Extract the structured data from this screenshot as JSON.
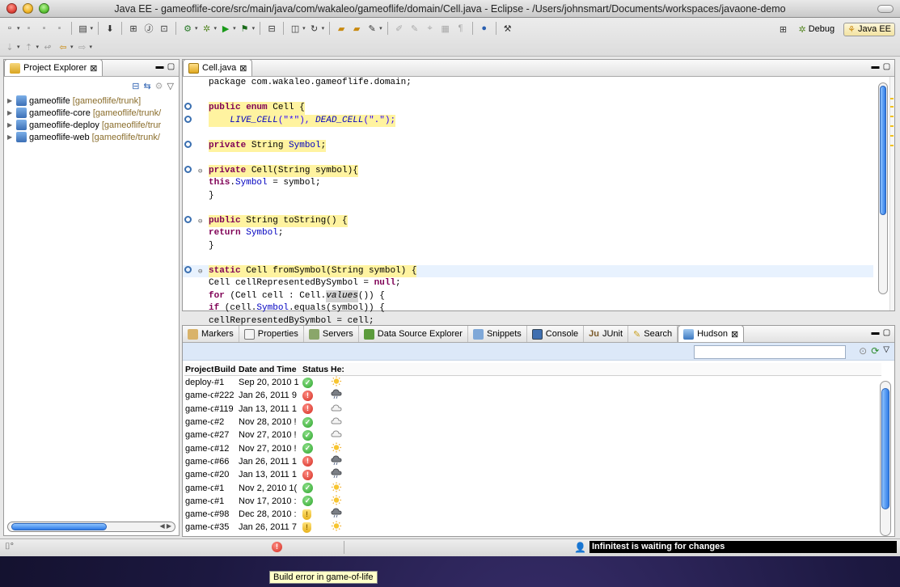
{
  "window": {
    "title": "Java EE - gameoflife-core/src/main/java/com/wakaleo/gameoflife/domain/Cell.java - Eclipse - /Users/johnsmart/Documents/workspaces/javaone-demo"
  },
  "perspectives": {
    "debug_label": "Debug",
    "javaee_label": "Java EE"
  },
  "project_explorer": {
    "title": "Project Explorer",
    "items": [
      {
        "name": "gameoflife",
        "repo": "[gameoflife/trunk]"
      },
      {
        "name": "gameoflife-core",
        "repo": "[gameoflife/trunk/"
      },
      {
        "name": "gameoflife-deploy",
        "repo": "[gameoflife/trur"
      },
      {
        "name": "gameoflife-web",
        "repo": "[gameoflife/trunk/"
      }
    ]
  },
  "editor": {
    "tab_label": "Cell.java",
    "code": {
      "l1": "package com.wakaleo.gameoflife.domain;",
      "l3a": "public enum",
      "l3b": " Cell {",
      "l4a": "LIVE_CELL",
      "l4b": "(\"*\"), ",
      "l4c": "DEAD_CELL",
      "l4d": "(\".\");",
      "l6a": "private",
      "l6b": " String ",
      "l6c": "Symbol",
      "l6d": ";",
      "l8a": "private",
      "l8b": " Cell(String symbol){",
      "l9a": "this",
      "l9b": ".",
      "l9c": "Symbol",
      "l9d": " = symbol;",
      "l10": "}",
      "l12a": "public",
      "l12b": " String toString() {",
      "l13a": "return",
      "l13b": " ",
      "l13c": "Symbol",
      "l13d": ";",
      "l14": "}",
      "l16a": "static",
      "l16b": " Cell fromSymbol(String symbol) {",
      "l17a": "Cell cellRepresentedBySymbol = ",
      "l17b": "null",
      "l17c": ";",
      "l18a": "for",
      "l18b": " (Cell cell : Cell.",
      "l18c": "values",
      "l18d": "()) {",
      "l19a": "if",
      "l19b": " (cell.",
      "l19c": "Symbol",
      "l19d": ".equals(symbol)) {",
      "l20": "cellRepresentedBySymbol = cell;"
    }
  },
  "bottom_tabs": {
    "markers": "Markers",
    "properties": "Properties",
    "servers": "Servers",
    "dse": "Data Source Explorer",
    "snippets": "Snippets",
    "console": "Console",
    "junit": "JUnit",
    "search": "Search",
    "hudson": "Hudson"
  },
  "hudson": {
    "headers": {
      "project": "Project",
      "build": "Build",
      "date": "Date and Time",
      "status": "Status",
      "health": "He:"
    },
    "rows": [
      {
        "project": "deploy-",
        "build": "#1",
        "date": "Sep 20, 2010 1",
        "status": "success",
        "health": "sunny"
      },
      {
        "project": "game-c",
        "build": "#222",
        "date": "Jan 26, 2011 9",
        "status": "failure",
        "health": "stormy"
      },
      {
        "project": "game-c",
        "build": "#119",
        "date": "Jan 13, 2011 1",
        "status": "failure",
        "health": "cloudy"
      },
      {
        "project": "game-c",
        "build": "#2",
        "date": "Nov 28, 2010 !",
        "status": "success",
        "health": "cloudy"
      },
      {
        "project": "game-c",
        "build": "#27",
        "date": "Nov 27, 2010 !",
        "status": "success",
        "health": "cloudy"
      },
      {
        "project": "game-c",
        "build": "#12",
        "date": "Nov 27, 2010 !",
        "status": "success",
        "health": "sunny"
      },
      {
        "project": "game-c",
        "build": "#66",
        "date": "Jan 26, 2011 1",
        "status": "failure",
        "health": "stormy"
      },
      {
        "project": "game-c",
        "build": "#20",
        "date": "Jan 13, 2011 1",
        "status": "failure",
        "health": "stormy"
      },
      {
        "project": "game-c",
        "build": "#1",
        "date": "Nov 2, 2010 1(",
        "status": "success",
        "health": "sunny"
      },
      {
        "project": "game-c",
        "build": "#1",
        "date": "Nov 17, 2010 :",
        "status": "success",
        "health": "sunny"
      },
      {
        "project": "game-c",
        "build": "#98",
        "date": "Dec 28, 2010 :",
        "status": "unstable",
        "health": "stormy"
      },
      {
        "project": "game-c",
        "build": "#35",
        "date": "Jan 26, 2011 7",
        "status": "unstable",
        "health": "sunny"
      }
    ]
  },
  "statusbar": {
    "infinitest": "Infinitest is waiting for changes"
  },
  "tooltip": {
    "text": "Build error in game-of-life"
  },
  "colors": {
    "keyword": "#7f0055",
    "field": "#0000c0",
    "string": "#2a00ff",
    "accent": "#2f7be6"
  }
}
